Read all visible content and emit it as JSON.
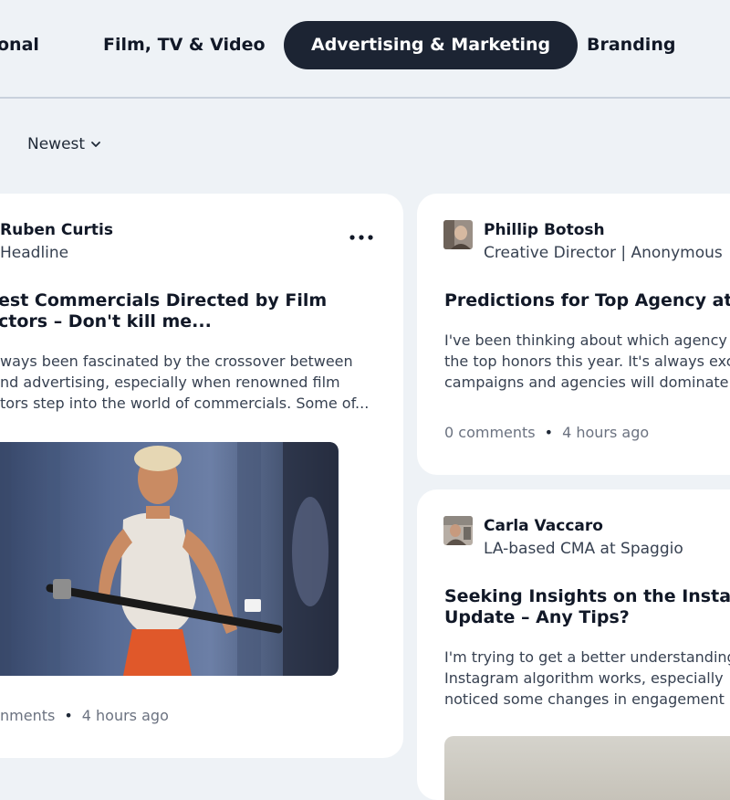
{
  "tabs": [
    {
      "label": "onal",
      "active": false
    },
    {
      "label": "Film, TV & Video",
      "active": false
    },
    {
      "label": "Advertising & Marketing",
      "active": true
    },
    {
      "label": "Branding",
      "active": false
    }
  ],
  "sort": {
    "label": "Newest",
    "icon": "chevron-down-icon"
  },
  "posts": [
    {
      "author": "Ruben Curtis",
      "subtitle": "Headline",
      "title": "est Commercials Directed by Film\nctors – Don't kill me...",
      "body": "ways been fascinated by the crossover between\nnd advertising, especially when renowned film\ntors step into the world of commercials. Some of...",
      "comments": "nments",
      "time": "4 hours ago",
      "menu_icon": "more-horizontal-icon",
      "image": "post-image"
    },
    {
      "author": "Phillip Botosh",
      "subtitle": "Creative Director | Anonymous",
      "title": "Predictions for Top Agency at Ca",
      "body": "I've been thinking about which agency\nthe top honors this year. It's always exci\ncampaigns and agencies will dominate",
      "comments": "0 comments",
      "time": "4 hours ago"
    },
    {
      "author": "Carla Vaccaro",
      "subtitle": "LA-based CMA at Spaggio",
      "title": "Seeking Insights on the Instagrar\nUpdate – Any Tips?",
      "body": "I'm trying to get a better understanding\nInstagram algorithm works, especially\nnoticed some changes in engagement",
      "comments": "",
      "time": ""
    }
  ],
  "colors": {
    "background": "#eef2f6",
    "active_tab": "#1c2433",
    "card": "#ffffff",
    "muted": "#6b7280"
  }
}
